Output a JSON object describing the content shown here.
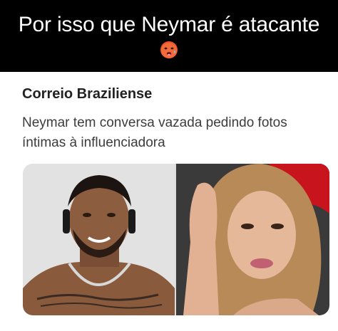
{
  "caption": {
    "text": "Por isso que Neymar é atacante",
    "emoji_icon": "hot-face-emoji-icon"
  },
  "card": {
    "source": "Correio Braziliense",
    "headline": "Neymar tem conversa vazada pedindo fotos íntimas à influenciadora",
    "images": [
      {
        "name": "neymar-photo",
        "description_icon": "person-photo"
      },
      {
        "name": "influencer-photo",
        "description_icon": "person-photo"
      }
    ]
  },
  "colors": {
    "caption_bg": "#000000",
    "caption_text": "#ffffff",
    "card_bg": "#ffffff",
    "source_text": "#222222",
    "headline_text": "#3c3c3c"
  }
}
